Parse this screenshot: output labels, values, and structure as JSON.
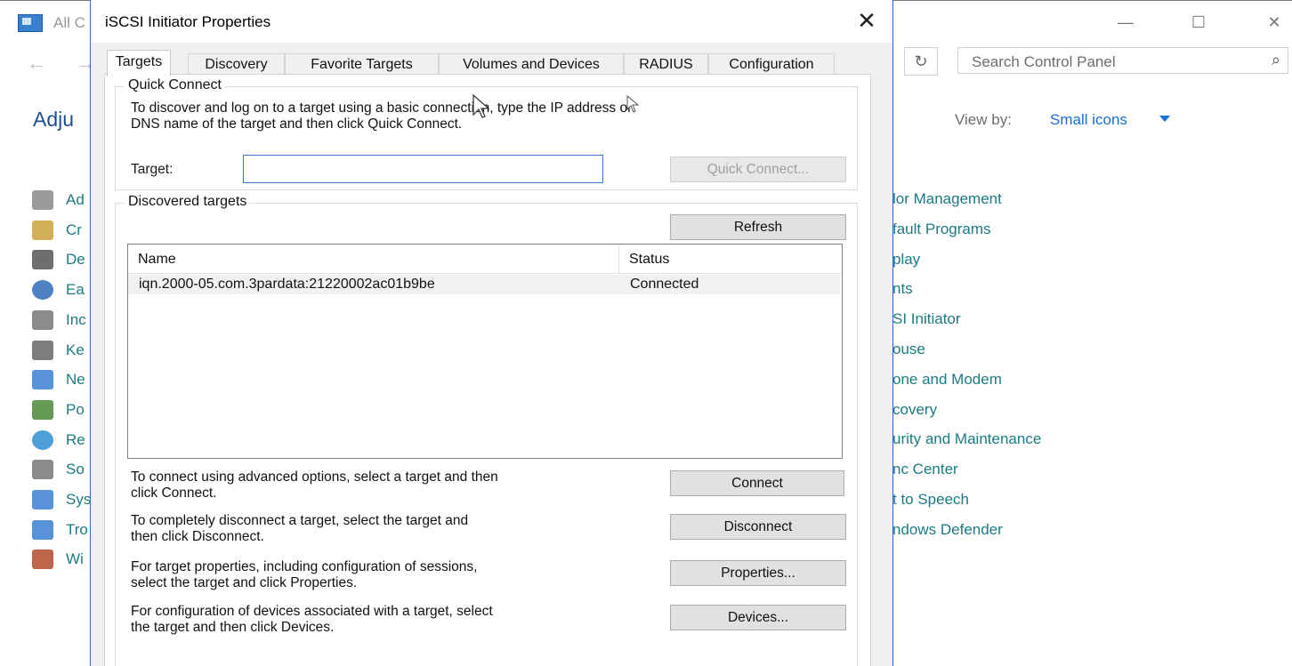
{
  "control_panel": {
    "title_fragment": "All C",
    "search_placeholder": "Search Control Panel",
    "heading_fragment": "Adju",
    "view_by_label": "View by:",
    "view_by_value": "Small icons",
    "left_items": [
      {
        "label": "Ad",
        "icon": "admin-tools-icon"
      },
      {
        "label": "Cr",
        "icon": "credential-manager-icon"
      },
      {
        "label": "De",
        "icon": "devices-icon"
      },
      {
        "label": "Ea",
        "icon": "ease-of-access-icon"
      },
      {
        "label": "Inc",
        "icon": "indexing-icon"
      },
      {
        "label": "Ke",
        "icon": "keyboard-icon"
      },
      {
        "label": "Ne",
        "icon": "network-icon"
      },
      {
        "label": "Po",
        "icon": "power-icon"
      },
      {
        "label": "Re",
        "icon": "region-icon"
      },
      {
        "label": "So",
        "icon": "sound-icon"
      },
      {
        "label": "Sys",
        "icon": "system-icon"
      },
      {
        "label": "Tro",
        "icon": "troubleshooting-icon"
      },
      {
        "label": "Wi",
        "icon": "firewall-icon"
      }
    ],
    "right_items": [
      "lor Management",
      "fault Programs",
      "play",
      "nts",
      "SI Initiator",
      "ouse",
      "one and Modem",
      "covery",
      "urity and Maintenance",
      "nc Center",
      "t to Speech",
      "ndows Defender"
    ]
  },
  "dialog": {
    "title": "iSCSI Initiator Properties",
    "tabs": [
      "Targets",
      "Discovery",
      "Favorite Targets",
      "Volumes and Devices",
      "RADIUS",
      "Configuration"
    ],
    "active_tab": "Targets",
    "quick_connect": {
      "legend": "Quick Connect",
      "description_line1": "To discover and log on to a target using a basic connection, type the IP address or",
      "description_line2": "DNS name of the target and then click Quick Connect.",
      "target_label": "Target:",
      "target_value": "",
      "button": "Quick Connect..."
    },
    "discovered": {
      "legend": "Discovered targets",
      "refresh_button": "Refresh",
      "columns": [
        "Name",
        "Status"
      ],
      "rows": [
        {
          "name": "iqn.2000-05.com.3pardata:21220002ac01b9be",
          "status": "Connected"
        }
      ]
    },
    "actions": [
      {
        "line1": "To connect using advanced options, select a target and then",
        "line2": "click Connect.",
        "button": "Connect"
      },
      {
        "line1": "To completely disconnect a target, select the target and",
        "line2": "then click Disconnect.",
        "button": "Disconnect"
      },
      {
        "line1": "For target properties, including configuration of sessions,",
        "line2": "select the target and click Properties.",
        "button": "Properties..."
      },
      {
        "line1": "For configuration of devices associated with a target, select",
        "line2": "the target and then click Devices.",
        "button": "Devices..."
      }
    ]
  }
}
